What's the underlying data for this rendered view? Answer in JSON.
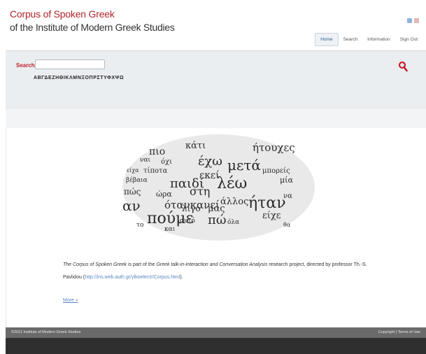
{
  "header": {
    "title_line1": "Corpus of Spoken Greek",
    "title_line2": "of the Institute of Modern Greek Studies",
    "flags": [
      "greek-flag-icon",
      "uk-flag-icon"
    ],
    "nav": [
      {
        "label": "Home",
        "active": true
      },
      {
        "label": "Search"
      },
      {
        "label": "Information"
      },
      {
        "label": "Sign Out"
      }
    ]
  },
  "search": {
    "label": "Search:",
    "value": "",
    "placeholder": "",
    "alphabet": "ΑΒΓΔΕΖΗΘΙΚΛΜΝΞΟΠΡΣΤΥΦΧΨΩ",
    "icon": "search-icon"
  },
  "cloud_words": [
    "πιο",
    "κάτι",
    "ήτουχες",
    "ναι",
    "όχι",
    "έχω",
    "μετά",
    "είχα",
    "τίποτα",
    "εκεί",
    "μπορείς",
    "βέβαια",
    "λέω",
    "παιδί",
    "μία",
    "πώς",
    "ώρα",
    "στη",
    "αν",
    "ότανκανεί",
    "άλλος",
    "ήταν",
    "λίγο",
    "μας",
    "πούμε",
    "είχε",
    "πώ",
    "όλα",
    "αυτό",
    "να",
    "το",
    "και",
    "θα"
  ],
  "description": {
    "p1_italic1": "The Corpus of Spoken Greek",
    "p1_text1": " is part of the ",
    "p1_italic2": "Greek talk-in-interaction and Conversation Analysis",
    "p1_text2": " research project, directed by professor Th.-S.",
    "p1_line2": "Pavlidou (",
    "p1_link": "http://ins.web.auth.gr/ylkoelectr/Corpus.html",
    "p1_end": ").",
    "more": "More »"
  },
  "footer": {
    "copyright": "©2011 Institute of Modern Greek Studies",
    "right": "Copyright | Terms of Use"
  },
  "colors": {
    "brand_red": "#b1252b",
    "link_blue": "#5b86c0",
    "band_gray": "#ebeef1",
    "footer_gray": "#6a6a6a",
    "footer_dark": "#2f2f2f"
  }
}
